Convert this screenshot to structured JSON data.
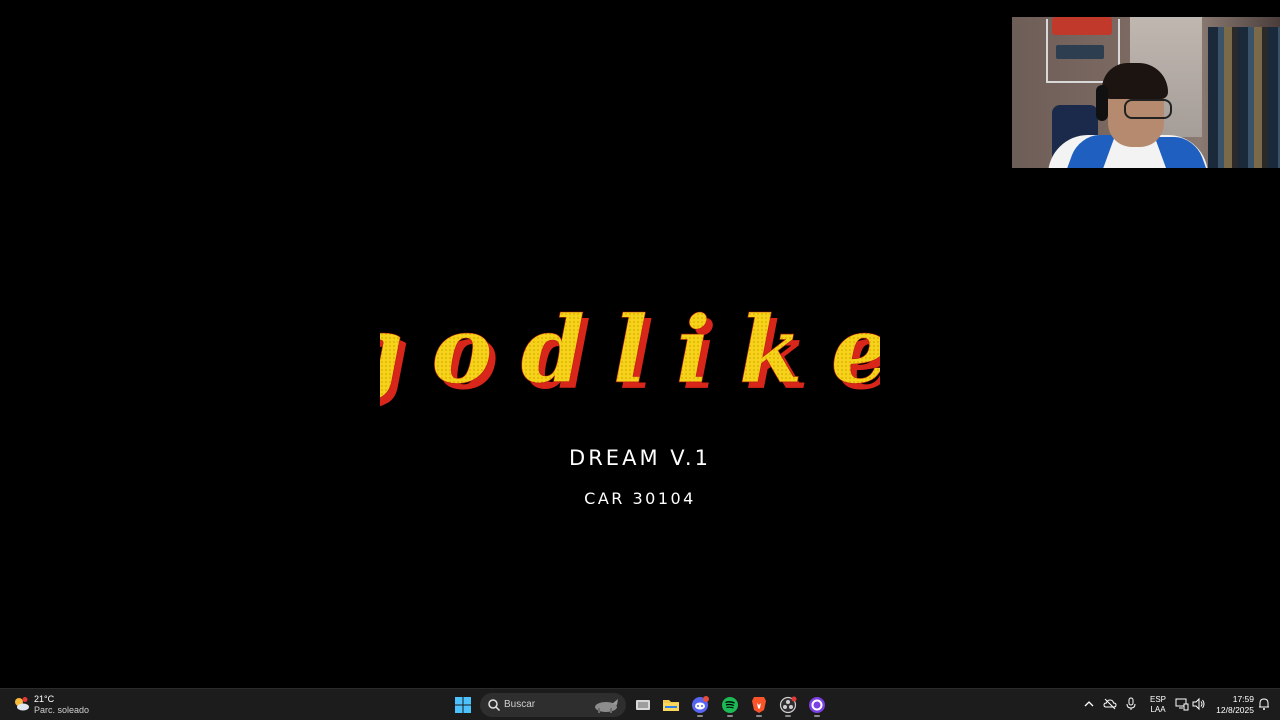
{
  "stream": {
    "title_logo": "godlike",
    "subtitle": "DREAM V.1",
    "subtitle2": "CAR 30104",
    "colors": {
      "background": "#000000",
      "logo_fill": "#f5d31a",
      "logo_shadow": "#d8261a",
      "text": "#ffffff"
    }
  },
  "taskbar": {
    "weather": {
      "temperature": "21°C",
      "description": "Parc. soleado",
      "icon": "partly-sunny-icon",
      "badge": "2"
    },
    "start_icon": "windows-start-icon",
    "search": {
      "placeholder": "Buscar"
    },
    "apps": [
      {
        "name": "task-view-icon"
      },
      {
        "name": "file-explorer-icon"
      },
      {
        "name": "discord-icon"
      },
      {
        "name": "spotify-icon"
      },
      {
        "name": "brave-icon"
      },
      {
        "name": "obs-icon"
      },
      {
        "name": "cortana-icon"
      }
    ],
    "tray": {
      "language_line1": "ESP",
      "language_line2": "LAA",
      "time": "17:59",
      "date": "12/8/2025"
    }
  }
}
